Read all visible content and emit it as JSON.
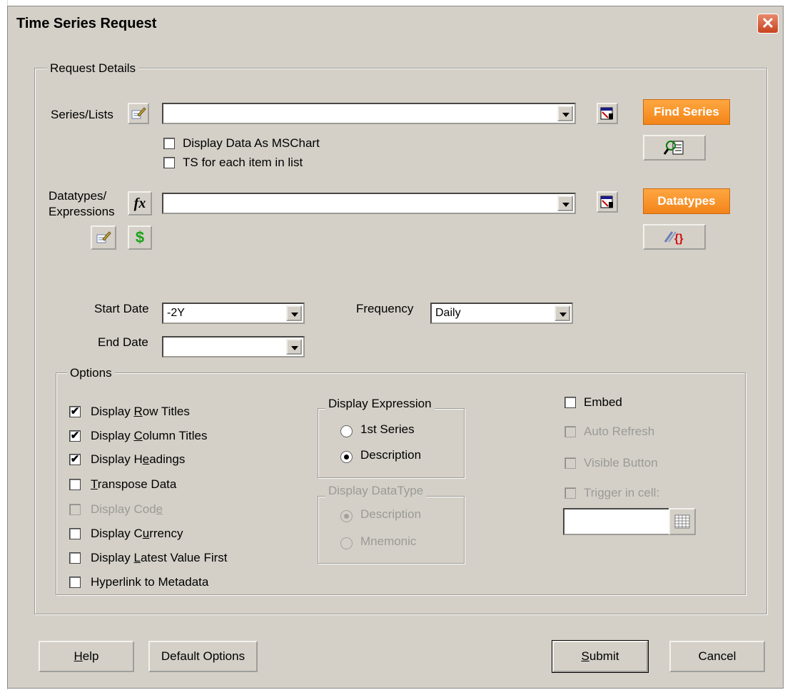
{
  "window": {
    "title": "Time Series Request",
    "close_glyph": "✕"
  },
  "request_details": {
    "legend": "Request Details",
    "series_label": "Series/Lists",
    "series_value": "",
    "display_mschart": {
      "label": "Display Data As MSChart",
      "checked": false
    },
    "ts_each_item": {
      "label": "TS for each item in list",
      "checked": false
    },
    "find_series_label": "Find Series",
    "datatypes_label_line1": "Datatypes/",
    "datatypes_label_line2": "Expressions",
    "datatypes_value": "",
    "datatypes_button_label": "Datatypes",
    "fx_glyph": "fx",
    "dollar_glyph": "$",
    "start_date_label": "Start Date",
    "start_date_value": "-2Y",
    "end_date_label": "End Date",
    "end_date_value": "",
    "frequency_label": "Frequency",
    "frequency_value": "Daily"
  },
  "options": {
    "legend": "Options",
    "checkboxes": [
      {
        "pre": "Display ",
        "u": "R",
        "post": "ow Titles",
        "checked": true,
        "disabled": false
      },
      {
        "pre": "Display ",
        "u": "C",
        "post": "olumn Titles",
        "checked": true,
        "disabled": false
      },
      {
        "pre": "Display H",
        "u": "e",
        "post": "adings",
        "checked": true,
        "disabled": false
      },
      {
        "pre": "",
        "u": "T",
        "post": "ranspose Data",
        "checked": false,
        "disabled": false
      },
      {
        "pre": "Display Cod",
        "u": "e",
        "post": "",
        "checked": false,
        "disabled": true
      },
      {
        "pre": "Display C",
        "u": "u",
        "post": "rrency",
        "checked": false,
        "disabled": false
      },
      {
        "pre": "Display ",
        "u": "L",
        "post": "atest Value First",
        "checked": false,
        "disabled": false
      },
      {
        "pre": "Hyperlink to Metadata",
        "u": "",
        "post": "",
        "checked": false,
        "disabled": false
      }
    ],
    "display_expression": {
      "legend": "Display Expression",
      "first_series": "1st Series",
      "description": "Description",
      "selected": "description"
    },
    "display_datatype": {
      "legend": "Display DataType",
      "description": "Description",
      "mnemonic": "Mnemonic",
      "selected": "description"
    },
    "embed": {
      "label": "Embed",
      "checked": false
    },
    "auto_refresh": {
      "label": "Auto Refresh",
      "checked": false
    },
    "visible_button": {
      "label": "Visible Button",
      "checked": false
    },
    "trigger_in_cell": {
      "label": "Trigger in cell:",
      "checked": false,
      "value": ""
    }
  },
  "footer": {
    "help_u": "H",
    "help_rest": "elp",
    "default_options": "Default Options",
    "submit_u": "S",
    "submit_rest": "ubmit",
    "cancel": "Cancel"
  },
  "colors": {
    "dialog_bg": "#d4d0c8",
    "orange": "#f2851a",
    "close_red": "#c8431f",
    "dollar_green": "#1aa31a"
  }
}
